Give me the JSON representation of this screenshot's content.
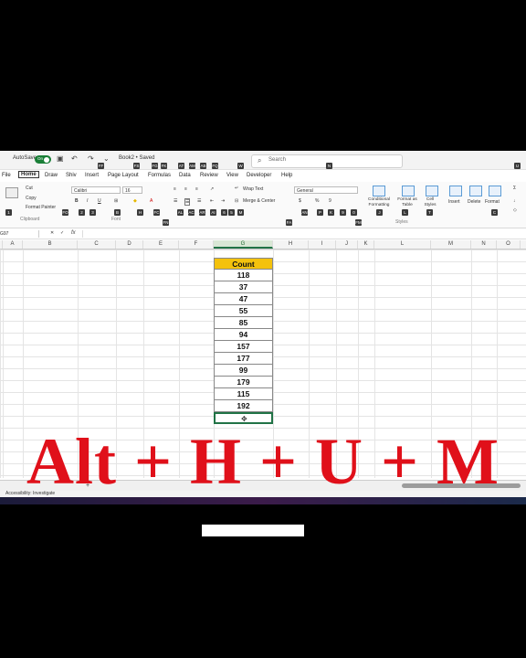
{
  "titlebar": {
    "autosave_label": "AutoSave",
    "autosave_state": "On",
    "doc_title": "Book2 • Saved",
    "search_placeholder": "Search"
  },
  "menu": {
    "tabs": [
      "File",
      "Home",
      "Draw",
      "Shiv",
      "Insert",
      "Page Layout",
      "Formulas",
      "Data",
      "Review",
      "View",
      "Developer",
      "Help"
    ],
    "active": "Home"
  },
  "ribbon": {
    "cut": "Cut",
    "copy": "Copy",
    "format_painter": "Format Painter",
    "clipboard": "Clipboard",
    "font_name": "Calibri",
    "font_size": "16",
    "font_group": "Font",
    "wrap_text": "Wrap Text",
    "merge_center": "Merge & Center",
    "number_format": "General",
    "conditional_formatting": "Conditional Formatting",
    "format_as_table": "Format as Table",
    "cell_styles": "Cell Styles",
    "insert": "Insert",
    "delete": "Delete",
    "format": "Format",
    "styles": "Styles",
    "keytips_row1": [
      "FF",
      "FS",
      "FG",
      "FK",
      "AT",
      "AM",
      "AB",
      "FQ",
      "W",
      "N",
      "U"
    ],
    "keytips_row2": [
      "1",
      "2",
      "3",
      "B",
      "H",
      "FC",
      "AL",
      "AC",
      "AR",
      "AI",
      "6",
      "5",
      "M",
      "AN",
      "P",
      "K",
      "9",
      "0",
      "J",
      "L",
      "T",
      "C"
    ],
    "keytips_row3": [
      "FO",
      "FN",
      "FA",
      "FM"
    ]
  },
  "formula_bar": {
    "name_box": "G97",
    "fx": "fx"
  },
  "columns": [
    "A",
    "B",
    "C",
    "D",
    "E",
    "F",
    "G",
    "H",
    "I",
    "J",
    "K",
    "L",
    "M",
    "N",
    "O"
  ],
  "selected_column": "G",
  "table": {
    "header": "Count",
    "values": [
      "118",
      "37",
      "47",
      "55",
      "85",
      "94",
      "157",
      "177",
      "99",
      "179",
      "115",
      "192"
    ]
  },
  "status": {
    "accessibility": "Accessibility: Investigate"
  },
  "overlay_text": "Alt + H + U + M",
  "colors": {
    "header_fill": "#f4c20d",
    "overlay_red": "#e0101a",
    "excel_green": "#217346"
  }
}
